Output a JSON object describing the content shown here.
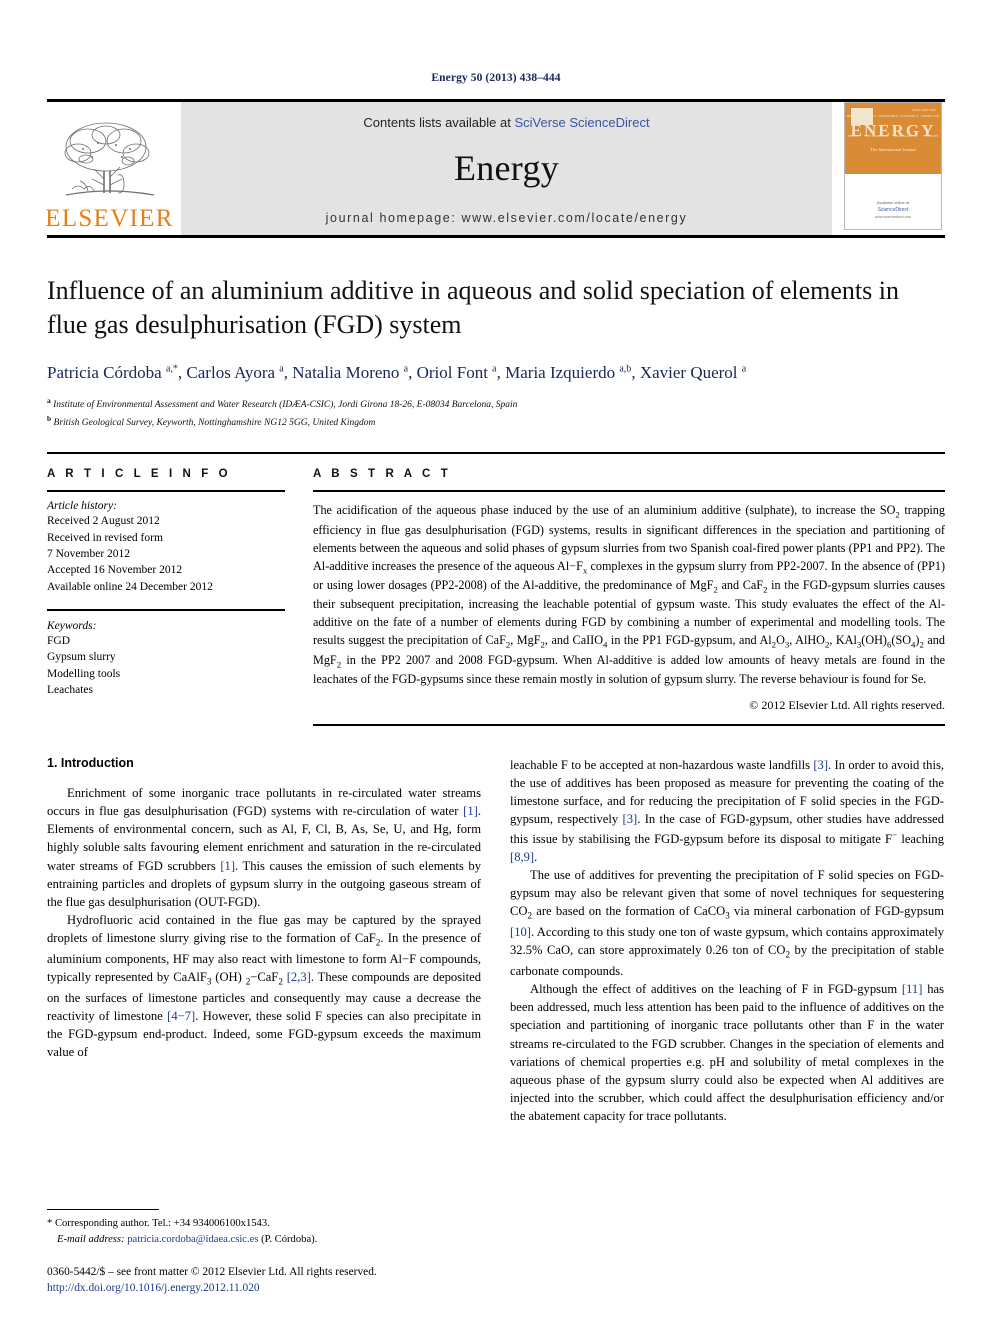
{
  "running_head": "Energy 50 (2013) 438–444",
  "masthead": {
    "logo_word": "ELSEVIER",
    "contents_prefix": "Contents lists available at ",
    "contents_link": "SciVerse ScienceDirect",
    "journal_title": "Energy",
    "homepage": "journal homepage: www.elsevier.com/locate/energy",
    "cover": {
      "title": "ENERGY",
      "subtitle": "The International Journal",
      "issn": "ISSN 0360-5442",
      "topics_row1": [
        "THERMODYNAMICS",
        "RENEWABLE",
        "EFFICIENCY",
        "MODELLING"
      ],
      "topics_row2": [
        "POWER",
        "ENVIRONMENT",
        "MANAGEMENT",
        "SYSTEMS"
      ],
      "available_at": "Available online at",
      "provider": "ScienceDirect",
      "provider_url": "www.sciencedirect.com"
    },
    "accent_color": "#E87E18",
    "link_color": "#3a53a4"
  },
  "article": {
    "title": "Influence of an aluminium additive in aqueous and solid speciation of elements in flue gas desulphurisation (FGD) system",
    "authors_html": "Patricia Córdoba <sup>a,</sup><sup>*</sup>, Carlos Ayora <sup>a</sup>, Natalia Moreno <sup>a</sup>, Oriol Font <sup>a</sup>, Maria Izquierdo <sup>a,b</sup>, Xavier Querol <sup>a</sup>",
    "affiliation_a": "Institute of Environmental Assessment and Water Research (IDÆA-CSIC), Jordi Girona 18-26, E-08034 Barcelona, Spain",
    "affiliation_b": "British Geological Survey, Keyworth, Nottinghamshire NG12 5GG, United Kingdom"
  },
  "info": {
    "heading": "A R T I C L E   I N F O",
    "history_label": "Article history:",
    "history": [
      "Received 2 August 2012",
      "Received in revised form",
      "7 November 2012",
      "Accepted 16 November 2012",
      "Available online 24 December 2012"
    ],
    "keywords_label": "Keywords:",
    "keywords": [
      "FGD",
      "Gypsum slurry",
      "Modelling tools",
      "Leachates"
    ]
  },
  "abstract": {
    "heading": "A B S T R A C T",
    "paragraph_html": "The acidification of the aqueous phase induced by the use of an aluminium additive (sulphate), to increase the SO<sub>2</sub> trapping efficiency in flue gas desulphurisation (FGD) systems, results in significant differences in the speciation and partitioning of elements between the aqueous and solid phases of gypsum slurries from two Spanish coal-fired power plants (PP1 and PP2). The Al-additive increases the presence of the aqueous Al&minus;F<sub>x</sub> complexes in the gypsum slurry from PP2-2007. In the absence of (PP1) or using lower dosages (PP2-2008) of the Al-additive, the predominance of MgF<sub>2</sub> and CaF<sub>2</sub> in the FGD-gypsum slurries causes their subsequent precipitation, increasing the leachable potential of gypsum waste. This study evaluates the effect of the Al-additive on the fate of a number of elements during FGD by combining a number of experimental and modelling tools. The results suggest the precipitation of CaF<sub>2</sub>, MgF<sub>2</sub>, and CaIIO<sub>4</sub> in the PP1 FGD-gypsum, and Al<sub>2</sub>O<sub>3</sub>, AlHO<sub>2</sub>, KAl<sub>3</sub>(OH)<sub>6</sub>(SO<sub>4</sub>)<sub>2</sub> and MgF<sub>2</sub> in the PP2 2007 and 2008 FGD-gypsum. When Al-additive is added low amounts of heavy metals are found in the leachates of the FGD-gypsums since these remain mostly in solution of gypsum slurry. The reverse behaviour is found for Se.",
    "copyright": "© 2012 Elsevier Ltd. All rights reserved."
  },
  "body": {
    "section_heading": "1.  Introduction",
    "left_paragraphs_html": [
      "Enrichment of some inorganic trace pollutants in re-circulated water streams occurs in flue gas desulphurisation (FGD) systems with re-circulation of water <span class=\"cite\">[1]</span>. Elements of environmental concern, such as Al, F, Cl, B, As, Se, U, and Hg, form highly soluble salts favouring element enrichment and saturation in the re-circulated water streams of FGD scrubbers <span class=\"cite\">[1]</span>. This causes the emission of such elements by entraining particles and droplets of gypsum slurry in the outgoing gaseous stream of the flue gas desulphurisation (OUT-FGD).",
      "Hydrofluoric acid contained in the flue gas may be captured by the sprayed droplets of limestone slurry giving rise to the formation of CaF<sub>2</sub>. In the presence of aluminium components, HF may also react with limestone to form Al&minus;F compounds, typically represented by CaAlF<sub>3</sub> (OH) <sub>2</sub>&minus;CaF<sub>2</sub> <span class=\"cite\">[2,3]</span>. These compounds are deposited on the surfaces of limestone particles and consequently may cause a decrease the reactivity of limestone <span class=\"cite\">[4&minus;7]</span>. However, these solid F species can also precipitate in the FGD-gypsum end-product. Indeed, some FGD-gypsum exceeds the maximum value of"
    ],
    "right_paragraphs_html": [
      "leachable F to be accepted at non-hazardous waste landfills <span class=\"cite\">[3]</span>. In order to avoid this, the use of additives has been proposed as measure for preventing the coating of the limestone surface, and for reducing the precipitation of F solid species in the FGD-gypsum, respectively <span class=\"cite\">[3]</span>. In the case of FGD-gypsum, other studies have addressed this issue by stabilising the FGD-gypsum before its disposal to mitigate F<sup>&minus;</sup> leaching <span class=\"cite\">[8,9]</span>.",
      "The use of additives for preventing the precipitation of F solid species on FGD-gypsum may also be relevant given that some of novel techniques for sequestering CO<sub>2</sub> are based on the formation of CaCO<sub>3</sub> via mineral carbonation of FGD-gypsum <span class=\"cite\">[10]</span>. According to this study one ton of waste gypsum, which contains approximately 32.5% CaO, can store approximately 0.26 ton of CO<sub>2</sub> by the precipitation of stable carbonate compounds.",
      "Although the effect of additives on the leaching of F in FGD-gypsum <span class=\"cite\">[11]</span> has been addressed, much less attention has been paid to the influence of additives on the speciation and partitioning of inorganic trace pollutants other than F in the water streams re-circulated to the FGD scrubber. Changes in the speciation of elements and variations of chemical properties e.g. pH and solubility of metal complexes in the aqueous phase of the gypsum slurry could also be expected when Al additives are injected into the scrubber, which could affect the desulphurisation efficiency and/or the abatement capacity for trace pollutants."
    ]
  },
  "footer": {
    "corresponding_html": "* Corresponding author. Tel.: +34 934006100x1543.",
    "email_label": "E-mail address:",
    "email": "patricia.cordoba@idaea.csic.es",
    "email_owner": "(P. Córdoba).",
    "front_matter": "0360-5442/$ – see front matter © 2012 Elsevier Ltd. All rights reserved.",
    "doi": "http://dx.doi.org/10.1016/j.energy.2012.11.020"
  }
}
